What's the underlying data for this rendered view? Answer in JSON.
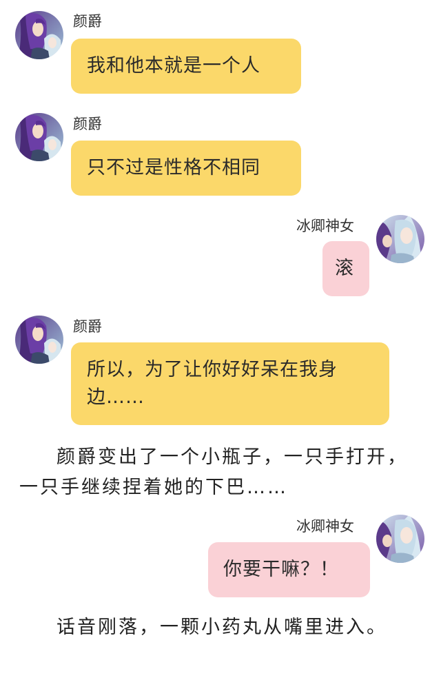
{
  "messages": [
    {
      "sender": "颜爵",
      "text": "我和他本就是一个人"
    },
    {
      "sender": "颜爵",
      "text": "只不过是性格不相同"
    },
    {
      "sender": "冰卿神女",
      "text": "滚"
    },
    {
      "sender": "颜爵",
      "text": "所以，为了让你好好呆在我身边……"
    },
    {
      "sender": "冰卿神女",
      "text": "你要干嘛？！"
    }
  ],
  "narration": [
    "颜爵变出了一个小瓶子，一只手打开，一只手继续捏着她的下巴……",
    "话音刚落，一颗小药丸从嘴里进入。"
  ],
  "colors": {
    "yellow_bubble": "#fbd86a",
    "pink_bubble": "#fad1d6",
    "background": "#ffffff"
  }
}
